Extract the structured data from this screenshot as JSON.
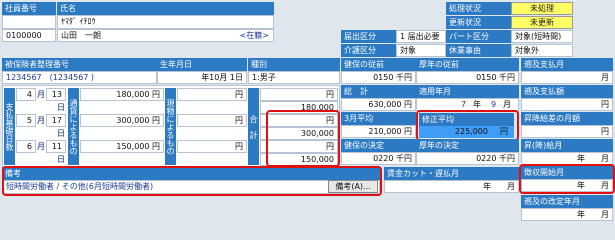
{
  "top": {
    "emp_no_label": "社員番号",
    "emp_no": "0100000",
    "name_label": "氏名",
    "kana": "ﾔﾏﾀﾞ ｲﾁﾛｳ",
    "name": "山田　一朗",
    "status": "<在籍>"
  },
  "status_panel": {
    "proc_label": "処理状況",
    "proc_value": "未処理",
    "upd_label": "更新状況",
    "upd_value": "未更新",
    "notif_label": "届出区分",
    "notif_code": "1",
    "notif_value": "届出必要",
    "part_label": "パート区分",
    "part_value": "対象(短時間)",
    "care_label": "介護区分",
    "care_value": "対象",
    "leave_label": "休業事由",
    "leave_value": "対象外"
  },
  "insured": {
    "label": "被保険者整理番号",
    "value": "1234567　(1234567 )"
  },
  "birth": {
    "label": "生年月日",
    "value": "年10月 1日"
  },
  "type": {
    "label": "種別",
    "value": "1:男子"
  },
  "health_prev": {
    "label": "健保の従前",
    "value": "0150 千円"
  },
  "pension_prev": {
    "label": "厚年の従前",
    "value": "0150 千円"
  },
  "retro_label": "遡及支払月",
  "retro_month": "月",
  "retro_amt_label": "遡及支払額",
  "retro_amt": "円",
  "total": {
    "label": "総　計",
    "value": "630,000 円"
  },
  "apply": {
    "label": "適用年月",
    "y": "7",
    "yu": "年",
    "m": "9",
    "mu": "月"
  },
  "avg": {
    "label": "3月平均",
    "value": "210,000 円"
  },
  "corr": {
    "label": "修正平均",
    "value": "225,000",
    "unit": "円"
  },
  "raise": {
    "label": "昇降給差の月額",
    "value": "円"
  },
  "health_dec": {
    "label": "健保の決定",
    "value": "0220 千円"
  },
  "pension_dec": {
    "label": "厚年の決定",
    "value": "0220 千円"
  },
  "raise_month": {
    "label": "昇(降)給月",
    "value": "年　　月"
  },
  "payday_label": "支払基礎日数",
  "cash_label": "通貨によるもの",
  "goods_label": "現物によるもの",
  "sum_label": "合　計",
  "rows": [
    {
      "month": "4",
      "mu": "月",
      "days": "13",
      "du": "日",
      "cash": "180,000 円",
      "goods": "円",
      "total": "180,000"
    },
    {
      "month": "5",
      "mu": "月",
      "days": "17",
      "du": "日",
      "cash": "300,000 円",
      "goods": "円",
      "total": "300,000"
    },
    {
      "month": "6",
      "mu": "月",
      "days": "11",
      "du": "日",
      "cash": "150,000 円",
      "goods": "円",
      "total": "150,000"
    }
  ],
  "yen": "円",
  "remarks": {
    "label": "備考",
    "value": "短時間労働者 / その他(6月短時間労働者)",
    "button": "備考(A)..."
  },
  "wage_cut": {
    "label": "賃金カット・遅払月",
    "value": "年　　月"
  },
  "collect": {
    "label": "徴収開始月",
    "value": "年　　月"
  },
  "retro_rev": {
    "label": "遡及の改定年月",
    "value": "年　　月"
  }
}
